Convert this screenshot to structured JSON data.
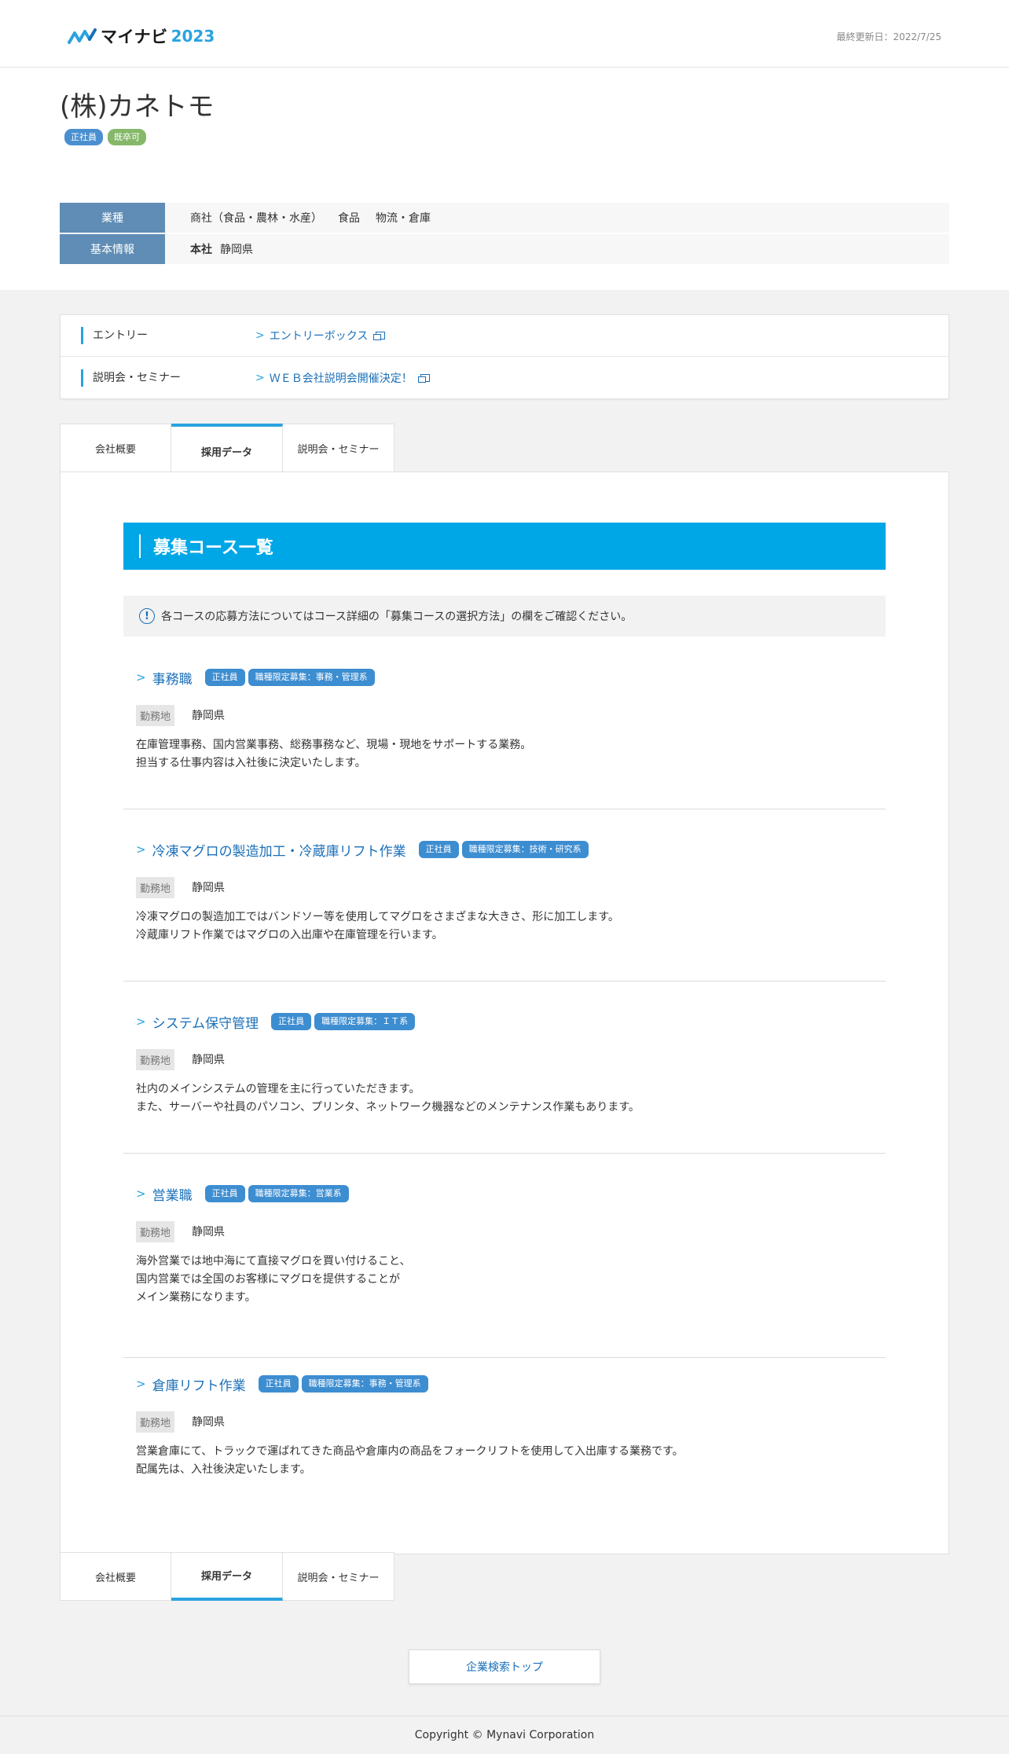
{
  "header": {
    "logo_text": "マイナビ",
    "logo_year": "2023",
    "last_updated": "最終更新日：2022/7/25"
  },
  "company": {
    "name": "(株)カネトモ",
    "tags": [
      "正社員",
      "既卒可"
    ],
    "industry_label": "業種",
    "industries": [
      "商社（食品・農林・水産）",
      "食品",
      "物流・倉庫"
    ],
    "basic_label": "基本情報",
    "hq_label": "本社",
    "hq_value": "静岡県"
  },
  "entry": {
    "rows": [
      {
        "label": "エントリー",
        "link": "エントリーボックス"
      },
      {
        "label": "説明会・セミナー",
        "link": "ＷＥＢ会社説明会開催決定！"
      }
    ]
  },
  "tabs": [
    "会社概要",
    "採用データ",
    "説明会・セミナー"
  ],
  "section": {
    "title": "募集コース一覧",
    "notice": "各コースの応募方法についてはコース詳細の「募集コースの選択方法」の欄をご確認ください。",
    "location_label": "勤務地"
  },
  "courses": [
    {
      "title": "事務職",
      "badges": [
        "正社員",
        "職種限定募集：事務・管理系"
      ],
      "location": "静岡県",
      "desc": [
        "在庫管理事務、国内営業事務、総務事務など、現場・現地をサポートする業務。",
        "担当する仕事内容は入社後に決定いたします。"
      ]
    },
    {
      "title": "冷凍マグロの製造加工・冷蔵庫リフト作業",
      "badges": [
        "正社員",
        "職種限定募集：技術・研究系"
      ],
      "location": "静岡県",
      "desc": [
        "冷凍マグロの製造加工ではバンドソー等を使用してマグロをさまざまな大きさ、形に加工します。",
        "冷蔵庫リフト作業ではマグロの入出庫や在庫管理を行います。"
      ]
    },
    {
      "title": "システム保守管理",
      "badges": [
        "正社員",
        "職種限定募集：ＩＴ系"
      ],
      "location": "静岡県",
      "desc": [
        "社内のメインシステムの管理を主に行っていただきます。",
        "また、サーバーや社員のパソコン、プリンタ、ネットワーク機器などのメンテナンス作業もあります。"
      ]
    },
    {
      "title": "営業職",
      "badges": [
        "正社員",
        "職種限定募集：営業系"
      ],
      "location": "静岡県",
      "desc": [
        "海外営業では地中海にて直接マグロを買い付けること、",
        "国内営業では全国のお客様にマグロを提供することが",
        "メイン業務になります。"
      ]
    },
    {
      "title": "倉庫リフト作業",
      "badges": [
        "正社員",
        "職種限定募集：事務・管理系"
      ],
      "location": "静岡県",
      "desc": [
        "営業倉庫にて、トラックで運ばれてきた商品や倉庫内の商品をフォークリフトを使用して入出庫する業務です。",
        "配属先は、入社後決定いたします。"
      ]
    }
  ],
  "bottom": {
    "top_button": "企業検索トップ",
    "copyright": "Copyright © Mynavi Corporation"
  },
  "colors": {
    "accent": "#00a7e6",
    "link": "#1a6fb8",
    "label_bg": "#5f8db5",
    "tag_green": "#86b86a"
  }
}
